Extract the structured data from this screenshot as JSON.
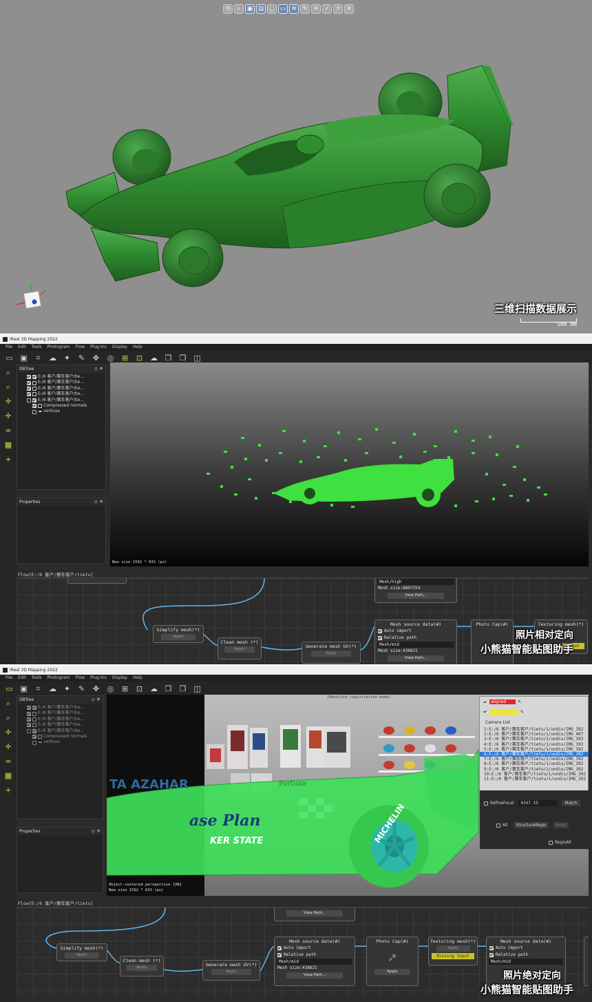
{
  "panel1": {
    "toolbar_icons": [
      "rotate-icon",
      "zoom-icon",
      "cube-icon",
      "front-view-icon",
      "cup-icon",
      "top-view-icon",
      "settings-icon",
      "pen-icon",
      "cross-icon",
      "check-icon",
      "light-icon",
      "close-icon"
    ],
    "caption": "三维扫描数据展示",
    "scale_label": "500   mm",
    "model_color": "#2f8a2f",
    "background_color": "#8f8f8f"
  },
  "app": {
    "title": "iReal 3D Mapping 2022",
    "menu": [
      "File",
      "Edit",
      "Tools",
      "Photogram",
      "Flow",
      "Plug-Ins",
      "Display",
      "Help"
    ],
    "dbtree_title": "DBTree",
    "properties_title": "Properties",
    "tree_items": [
      "E:/6 客户/赛车客户/tie…",
      "E:/6 客户/赛车客户/tie…",
      "E:/6 客户/赛车客户/tie…",
      "E:/6 客户/赛车客户/tie…",
      "E:/6 客户/赛车客户/tie…"
    ],
    "tree_sub_items": [
      "Compressed normals",
      "vertices"
    ]
  },
  "panel2": {
    "viewport_info": "New size 1592 * 633 (px)",
    "flow_header": "Flow[E:/6 客户/赛车客户/tietu]",
    "nodes": {
      "simplify": {
        "title": "Simplify mesh(*)",
        "button": "Apply"
      },
      "clean": {
        "title": "Clean mesh (*)",
        "button": "Apply"
      },
      "generate_uv": {
        "title": "Generate mesh UV(*)",
        "button": "Apply"
      },
      "mesh_high": {
        "title": "Mesh/high",
        "size": "Mesh size:8807254",
        "button": "View Path..."
      },
      "mesh_source": {
        "title": "Mesh source data(#)",
        "auto_import": "Auto import",
        "relative_path": "Relative path",
        "field": "Mesh/mid",
        "size": "Mesh size:438821",
        "button": "View Path..."
      },
      "photo_cap": {
        "title": "Photo Cap(#)"
      },
      "texturing": {
        "title": "Texturing mesh(*)",
        "warning": "Input"
      }
    },
    "watermark_line1": "照片相对定向",
    "watermark_line2": "小熊猫智能贴图助手"
  },
  "panel3": {
    "viewport_title": "[Absolute registration mode]",
    "viewport_info_1": "Object-centered perspective [ON]",
    "viewport_info_2": "New size 1592 * 633 (px)",
    "flow_header": "Flow[E:/6 客户/赛车客户/tietu]",
    "car_texts": [
      "TA AZAHAR",
      "ase Plan",
      "KER STATE",
      "MICHELIN",
      "Fortuna"
    ],
    "camera_panel": {
      "aligned_label": "aligned",
      "list_title": "Camera List",
      "cameras": [
        "1:E:/6 客户/赛车客户/tietu/1/undis/IMG_392",
        "2:E:/6 客户/赛车客户/tietu/1/undis/IMG_407",
        "3:E:/6 客户/赛车客户/tietu/1/undis/IMG_392",
        "4:E:/6 客户/赛车客户/tietu/1/undis/IMG_393",
        "5:E:/6 客户/赛车客户/tietu/1/undis/IMG_392",
        "6:E:/6 客户/赛车客户/tietu/1/undis/IMG_392",
        "7:E:/6 客户/赛车客户/tietu/1/undis/IMG_392",
        "8:E:/6 客户/赛车客户/tietu/1/undis/IMG_392",
        "9:E:/6 客户/赛车客户/tietu/1/undis/IMG_392",
        "10:E:/6 客户/赛车客户/tietu/1/undis/IMG_392",
        "11:E:/6 客户/赛车客户/tietu/1/undis/IMG_392"
      ],
      "selected_index": 5,
      "refine_focal_label": "RefineFocal",
      "refine_focal_value": "4347.19",
      "match_button": "Match",
      "all_label": "All",
      "structure_regis": "StructureRegis",
      "reset_button": "Reset",
      "regis_all_label": "RegisAll"
    },
    "nodes": {
      "simplify": {
        "title": "Simplify mesh(*)",
        "button": "Apply"
      },
      "clean": {
        "title": "Clean mesh (*)",
        "button": "Apply"
      },
      "generate_uv": {
        "title": "Generate mesh UV(*)",
        "button": "Apply"
      },
      "mesh_high": {
        "button": "View Path..."
      },
      "mesh_source": {
        "title": "Mesh source data(#)",
        "auto_import": "Auto import",
        "relative_path": "Relative path",
        "field": "Mesh/mid",
        "size": "Mesh size:438821",
        "button": "View Path..."
      },
      "photo_cap": {
        "title": "Photo Cap(#)",
        "button": "Apply"
      },
      "texturing": {
        "title": "Texturing mesh(*)",
        "button": "Apply",
        "warning": "Missing Input"
      },
      "mesh_source2": {
        "title": "Mesh source data(#)",
        "auto_import": "Auto import",
        "relative_path": "Relative path",
        "field": "Mesh/mid"
      }
    },
    "watermark_line1": "照片绝对定向",
    "watermark_line2": "小熊猫智能贴图助手"
  }
}
